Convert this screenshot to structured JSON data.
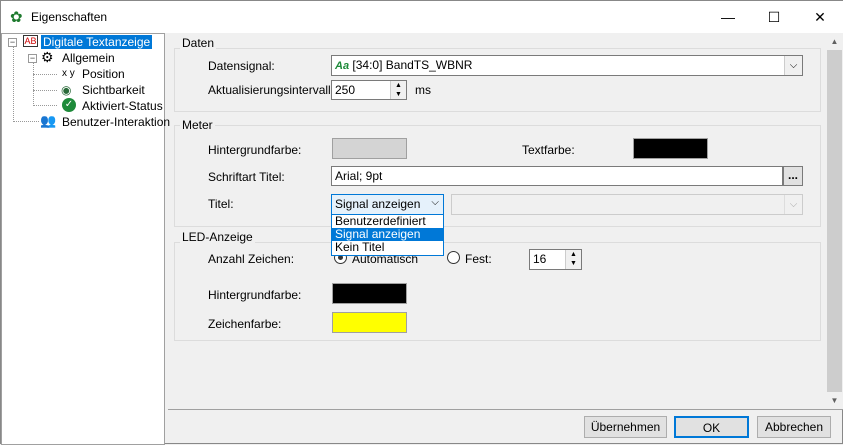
{
  "window": {
    "title": "Eigenschaften",
    "minimize": "—",
    "maximize": "☐",
    "close": "✕"
  },
  "tree": {
    "root": "Digitale Textanzeige",
    "general": "Allgemein",
    "position": "Position",
    "visibility": "Sichtbarkeit",
    "activated": "Aktiviert-Status",
    "interaction": "Benutzer-Interaktion"
  },
  "daten": {
    "title": "Daten",
    "signal_label": "Datensignal:",
    "signal_value": "[34:0] BandTS_WBNR",
    "signal_icon": "Aa",
    "interval_label": "Aktualisierungsintervall:",
    "interval_value": "250",
    "interval_unit": "ms"
  },
  "meter": {
    "title": "Meter",
    "bg_label": "Hintergrundfarbe:",
    "bg_color": "#d4d4d4",
    "text_label": "Textfarbe:",
    "text_color": "#000000",
    "font_label": "Schriftart Titel:",
    "font_value": "Arial; 9pt",
    "font_button": "...",
    "title_label": "Titel:",
    "title_value": "Signal anzeigen",
    "title_options": [
      "Benutzerdefiniert",
      "Signal anzeigen",
      "Kein Titel"
    ]
  },
  "led": {
    "title": "LED-Anzeige",
    "count_label": "Anzahl Zeichen:",
    "auto_label": "Automatisch",
    "fixed_label": "Fest:",
    "fixed_value": "16",
    "bg_label": "Hintergrundfarbe:",
    "bg_color": "#000000",
    "char_label": "Zeichenfarbe:",
    "char_color": "#ffff00"
  },
  "buttons": {
    "apply": "Übernehmen",
    "ok": "OK",
    "cancel": "Abbrechen"
  }
}
